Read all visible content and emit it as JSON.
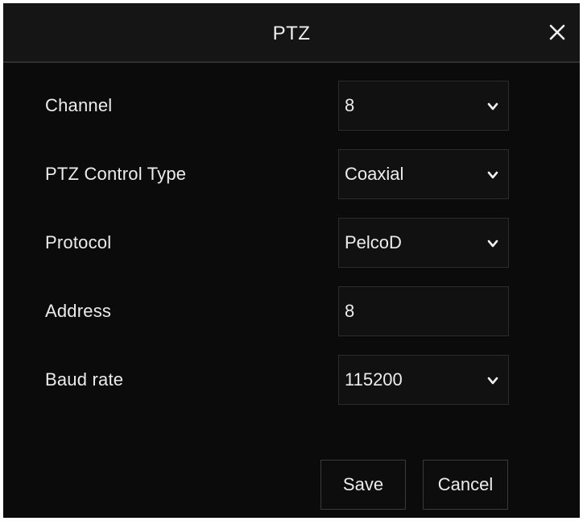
{
  "dialog": {
    "title": "PTZ",
    "close_icon": "close-icon"
  },
  "form": {
    "channel": {
      "label": "Channel",
      "value": "8",
      "type": "select"
    },
    "control_type": {
      "label": "PTZ Control Type",
      "value": "Coaxial",
      "type": "select"
    },
    "protocol": {
      "label": "Protocol",
      "value": "PelcoD",
      "type": "select"
    },
    "address": {
      "label": "Address",
      "value": "8",
      "type": "input"
    },
    "baud_rate": {
      "label": "Baud rate",
      "value": "115200",
      "type": "select"
    }
  },
  "buttons": {
    "save_label": "Save",
    "cancel_label": "Cancel"
  },
  "colors": {
    "background": "#0b0b0b",
    "field_background": "#111111",
    "text": "#ececec"
  }
}
